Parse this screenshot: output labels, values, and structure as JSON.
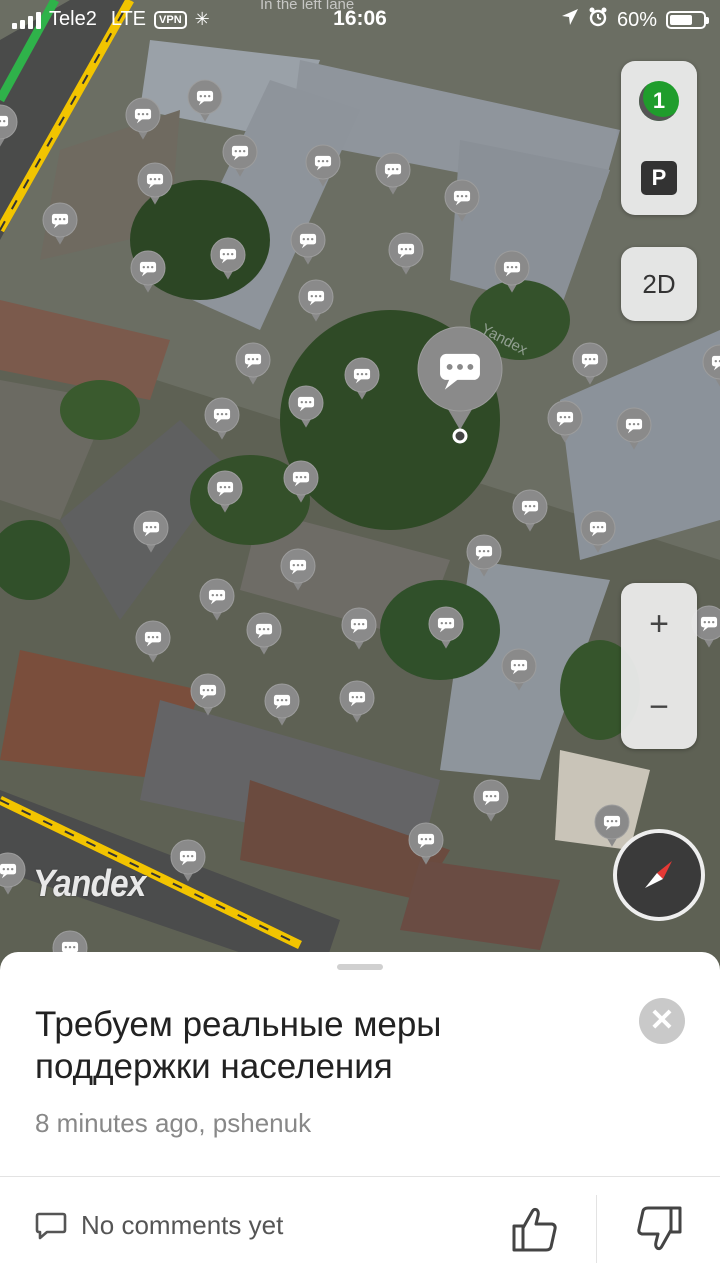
{
  "status_bar": {
    "carrier": "Tele2",
    "network": "LTE",
    "vpn": "VPN",
    "time": "16:06",
    "battery": "60%",
    "battery_level": 0.6
  },
  "map": {
    "lane_hint": "In the left lane",
    "watermark": "Yandex",
    "logo": "Yandex",
    "marker_icon": "comment-bubble-icon"
  },
  "controls": {
    "traffic_level": "1",
    "parking_label": "P",
    "mode_label": "2D",
    "zoom_in": "+",
    "zoom_out": "−"
  },
  "post": {
    "title": "Требуем реальные меры поддержки населения",
    "meta": "8 minutes ago, pshenuk",
    "comments": "No comments yet"
  },
  "colors": {
    "road_yellow": "#f2c400",
    "traffic_green": "#1f9d2c",
    "marker_gray": "#8a8a8a"
  }
}
